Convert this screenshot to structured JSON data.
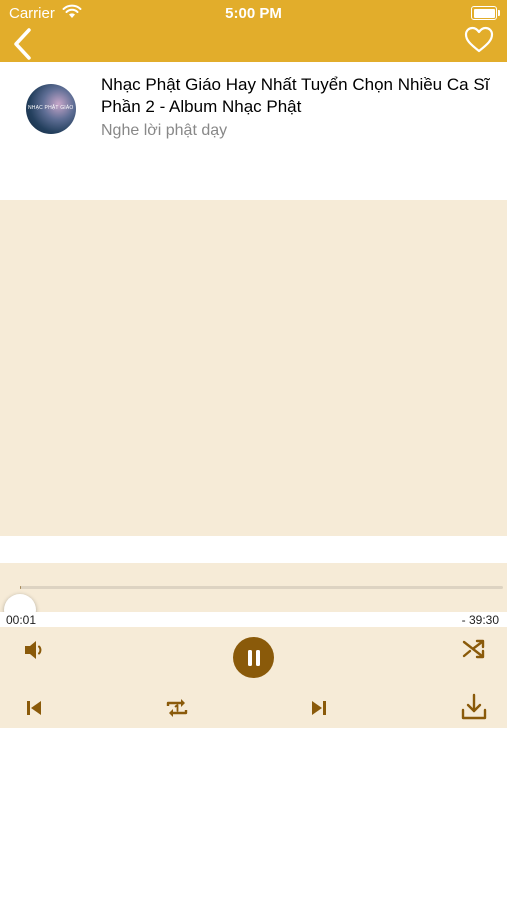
{
  "status_bar": {
    "carrier": "Carrier",
    "time": "5:00 PM"
  },
  "nav": {
    "back_icon": "chevron-left-icon",
    "favorite_icon": "heart-outline-icon",
    "bar_color": "#e2ad2b"
  },
  "song": {
    "title": "Nhạc Phật Giáo Hay Nhất Tuyển Chọn Nhiều Ca Sĩ Phần 2 - Album Nhạc Phật",
    "artist": "Nghe lời phật dạy",
    "artwork_caption": "NHẠC PHẬT GIÁO"
  },
  "player": {
    "elapsed": "00:01",
    "remaining": "- 39:30",
    "progress_fraction": 0.0004,
    "state": "playing",
    "accent_color": "#8a5a0a",
    "panel_color": "#f6ebd7"
  },
  "controls": {
    "volume_icon": "volume-icon",
    "play_pause_icon": "pause-icon",
    "shuffle_icon": "shuffle-icon",
    "previous_icon": "skip-previous-icon",
    "repeat_icon": "repeat-one-icon",
    "next_icon": "skip-next-icon",
    "download_icon": "download-icon"
  }
}
